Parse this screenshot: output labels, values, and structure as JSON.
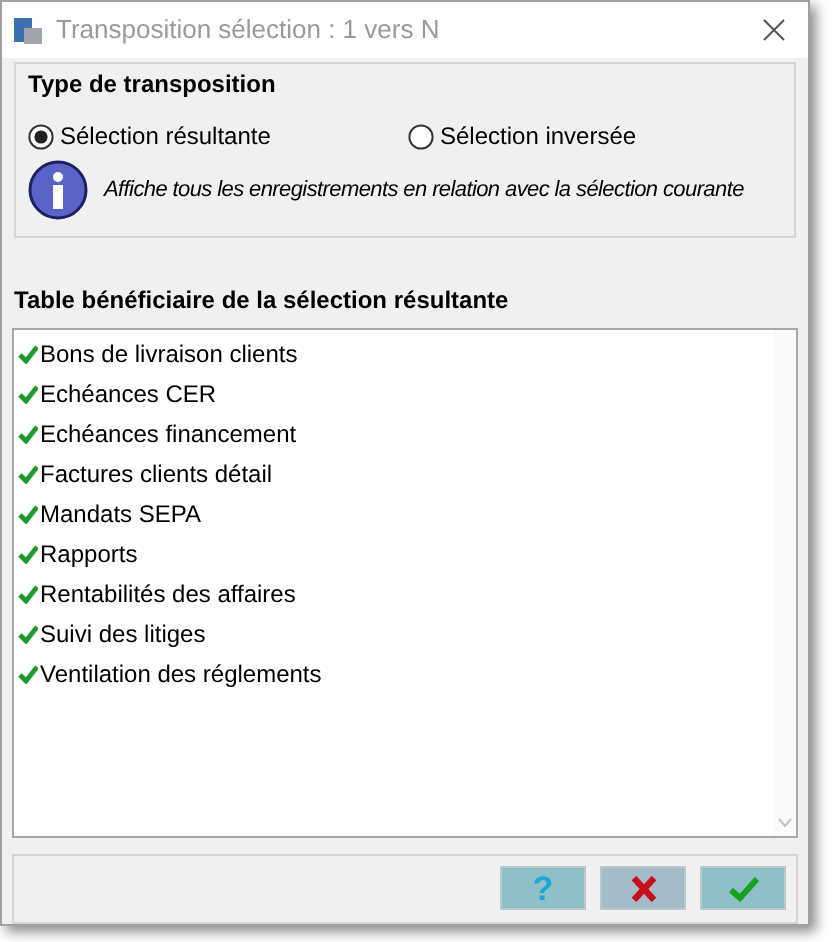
{
  "window": {
    "title": "Transposition sélection : 1 vers N"
  },
  "transposition_type": {
    "title": "Type de transposition",
    "options": [
      {
        "label": "Sélection résultante",
        "selected": true
      },
      {
        "label": "Sélection inversée",
        "selected": false
      }
    ],
    "info": "Affiche tous les enregistrements en relation avec la sélection courante"
  },
  "table": {
    "title": "Table bénéficiaire de la sélection résultante",
    "items": [
      {
        "label": "Bons de livraison clients",
        "checked": true
      },
      {
        "label": "Echéances CER",
        "checked": true
      },
      {
        "label": "Echéances financement",
        "checked": true
      },
      {
        "label": "Factures clients détail",
        "checked": true
      },
      {
        "label": "Mandats SEPA",
        "checked": true
      },
      {
        "label": "Rapports",
        "checked": true
      },
      {
        "label": "Rentabilités des affaires",
        "checked": true
      },
      {
        "label": "Suivi des litiges",
        "checked": true
      },
      {
        "label": "Ventilation des réglements",
        "checked": true
      }
    ]
  },
  "buttons": {
    "help": "?"
  }
}
